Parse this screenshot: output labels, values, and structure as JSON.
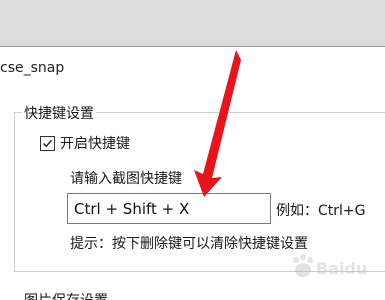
{
  "window": {
    "title": "cse_snap"
  },
  "hotkey_group": {
    "title": "快捷键设置",
    "enable_checkbox": {
      "label": "开启快捷键",
      "checked": true
    },
    "prompt": "请输入截图快捷键",
    "input_value": "Ctrl + Shift + X",
    "example": "例如：Ctrl+G",
    "hint": "提示：按下删除键可以清除快捷键设置"
  },
  "next_section": {
    "title": "图片保存设置"
  },
  "annotation": {
    "arrow_color": "#e8141c"
  },
  "watermark": {
    "text": "Baidu"
  }
}
